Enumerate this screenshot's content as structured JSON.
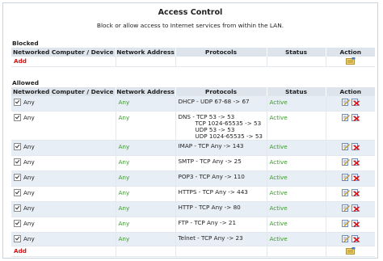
{
  "page": {
    "title": "Access Control",
    "description": "Block or allow access to Internet services from within the LAN."
  },
  "blocked": {
    "heading": "Blocked",
    "add_label": "Add"
  },
  "columns": [
    "Networked Computer / Device",
    "Network Address",
    "Protocols",
    "Status",
    "Action"
  ],
  "allowed": {
    "heading": "Allowed",
    "add_label": "Add",
    "rows": [
      {
        "device": "Any",
        "address": "Any",
        "protocols": [
          "DHCP - UDP 67-68 -> 67"
        ],
        "status": "Active"
      },
      {
        "device": "Any",
        "address": "Any",
        "protocols": [
          "DNS - TCP 53 -> 53",
          "TCP 1024-65535 -> 53",
          "UDP 53 -> 53",
          "UDP 1024-65535 -> 53"
        ],
        "status": "Active"
      },
      {
        "device": "Any",
        "address": "Any",
        "protocols": [
          "IMAP - TCP Any -> 143"
        ],
        "status": "Active"
      },
      {
        "device": "Any",
        "address": "Any",
        "protocols": [
          "SMTP - TCP Any -> 25"
        ],
        "status": "Active"
      },
      {
        "device": "Any",
        "address": "Any",
        "protocols": [
          "POP3 - TCP Any -> 110"
        ],
        "status": "Active"
      },
      {
        "device": "Any",
        "address": "Any",
        "protocols": [
          "HTTPS - TCP Any -> 443"
        ],
        "status": "Active"
      },
      {
        "device": "Any",
        "address": "Any",
        "protocols": [
          "HTTP - TCP Any -> 80"
        ],
        "status": "Active"
      },
      {
        "device": "Any",
        "address": "Any",
        "protocols": [
          "FTP - TCP Any -> 21"
        ],
        "status": "Active"
      },
      {
        "device": "Any",
        "address": "Any",
        "protocols": [
          "Telnet - TCP Any -> 23"
        ],
        "status": "Active"
      }
    ]
  },
  "icons": {
    "add_action": "add-rule-icon",
    "edit_action": "edit-icon",
    "delete_action": "delete-icon"
  },
  "colors": {
    "header_bg": "#dde4ec",
    "alt_row_bg": "#e8eef5",
    "status_active": "#3a9a2a",
    "add_link": "#d41414"
  }
}
